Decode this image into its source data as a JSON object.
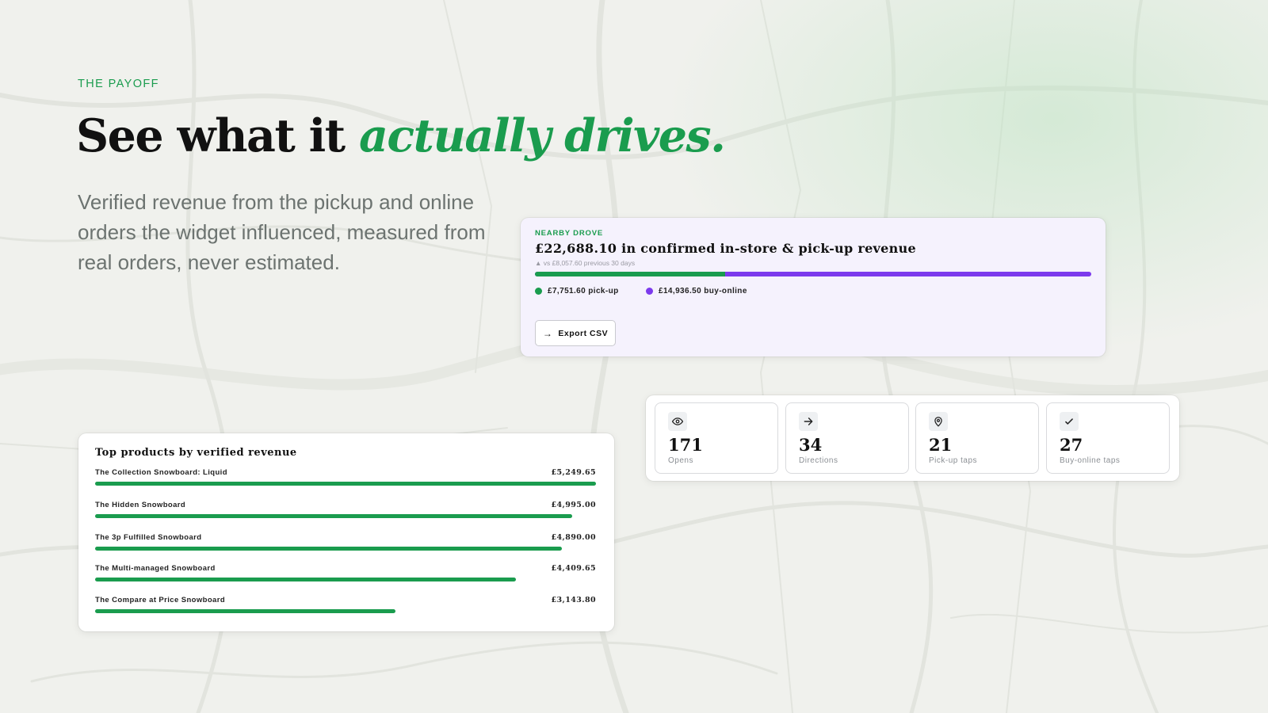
{
  "hero": {
    "eyebrow": "THE PAYOFF",
    "headline_plain": "See what it ",
    "headline_accent": "actually drives.",
    "subcopy": "Verified revenue from the pickup and online orders the widget influenced, measured from real orders, never estimated."
  },
  "revenue_card": {
    "eyebrow": "NEARBY DROVE",
    "title": "£22,688.10 in confirmed in-store & pick-up revenue",
    "delta": "▲ vs £8,057.60 previous 30 days",
    "pickup_share": 0.342,
    "legend": [
      {
        "label": "£7,751.60 pick-up",
        "color": "#1a9c4e"
      },
      {
        "label": "£14,936.50 buy-online",
        "color": "#7c3aed"
      }
    ],
    "export_label": "Export CSV",
    "export_icon": "arrow-right-icon"
  },
  "stats": [
    {
      "icon": "eye-icon",
      "value": "171",
      "label": "Opens"
    },
    {
      "icon": "arrow-right-icon",
      "value": "34",
      "label": "Directions"
    },
    {
      "icon": "map-pin-icon",
      "value": "21",
      "label": "Pick-up taps"
    },
    {
      "icon": "check-icon",
      "value": "27",
      "label": "Buy-online taps"
    }
  ],
  "top_products": {
    "title": "Top products by verified revenue",
    "items": [
      {
        "name": "The Collection Snowboard: Liquid",
        "value": "£5,249.65",
        "share": 1.0
      },
      {
        "name": "The Hidden Snowboard",
        "value": "£4,995.00",
        "share": 0.952
      },
      {
        "name": "The 3p Fulfilled Snowboard",
        "value": "£4,890.00",
        "share": 0.932
      },
      {
        "name": "The Multi-managed Snowboard",
        "value": "£4,409.65",
        "share": 0.84
      },
      {
        "name": "The Compare at Price Snowboard",
        "value": "£3,143.80",
        "share": 0.599
      }
    ]
  },
  "colors": {
    "accent_green": "#1a9c4e",
    "accent_purple": "#7c3aed",
    "revenue_card_bg": "#f5f2fd",
    "page_bg": "#f0f1ed"
  }
}
